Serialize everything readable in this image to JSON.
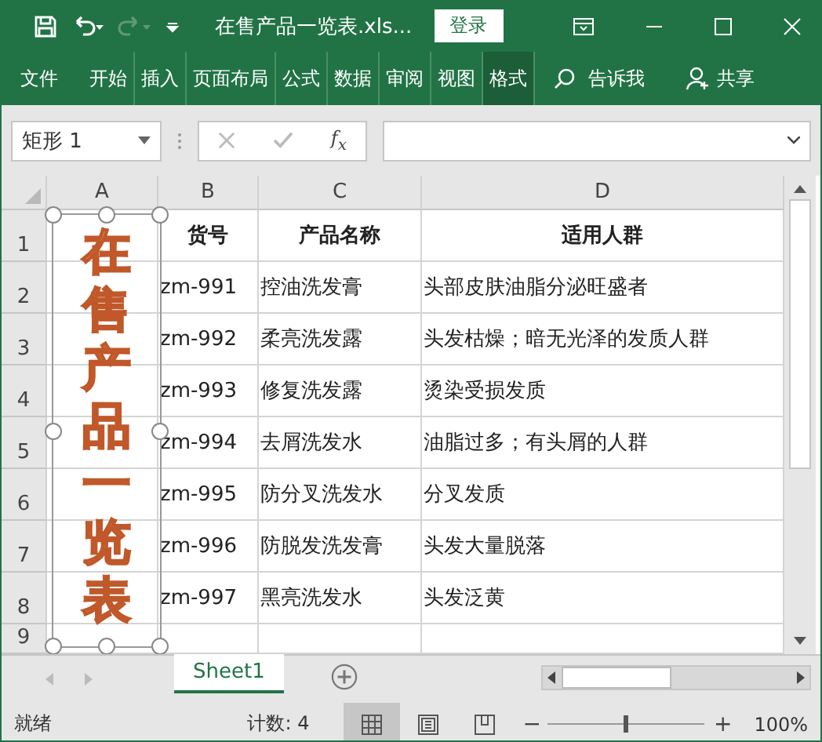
{
  "title_bar": {
    "title": "在售产品一览表.xls...",
    "login": "登录"
  },
  "ribbon_tabs": [
    {
      "label": "文件",
      "selected": false
    },
    {
      "label": "开始",
      "selected": false
    },
    {
      "label": "插入",
      "selected": false
    },
    {
      "label": "页面布局",
      "selected": false
    },
    {
      "label": "公式",
      "selected": false
    },
    {
      "label": "数据",
      "selected": false
    },
    {
      "label": "审阅",
      "selected": false
    },
    {
      "label": "视图",
      "selected": false
    },
    {
      "label": "格式",
      "selected": true
    }
  ],
  "tell_me": "告诉我",
  "share": "共享",
  "formula_bar": {
    "name_box": "矩形 1",
    "fx": "f$_{x}$"
  },
  "columns": [
    "A",
    "B",
    "C",
    "D"
  ],
  "rows": [
    {
      "number": "1",
      "cells": [
        "货号",
        "产品名称",
        "适用人群"
      ]
    },
    {
      "number": "2",
      "cells": [
        "zm-991",
        "控油洗发膏",
        "头部皮肤油脂分泌旺盛者"
      ]
    },
    {
      "number": "3",
      "cells": [
        "zm-992",
        "柔亮洗发露",
        "头发枯燥；暗无光泽的发质人群"
      ]
    },
    {
      "number": "4",
      "cells": [
        "zm-993",
        "修复洗发露",
        "烫染受损发质"
      ]
    },
    {
      "number": "5",
      "cells": [
        "zm-994",
        "去屑洗发水",
        "油脂过多；有头屑的人群"
      ]
    },
    {
      "number": "6",
      "cells": [
        "zm-995",
        "防分叉洗发水",
        "分叉发质"
      ]
    },
    {
      "number": "7",
      "cells": [
        "zm-996",
        "防脱发洗发膏",
        "头发大量脱落"
      ]
    },
    {
      "number": "8",
      "cells": [
        "zm-997",
        "黑亮洗发水",
        "头发泛黄"
      ]
    },
    {
      "number": "9",
      "cells": [
        "",
        "",
        ""
      ]
    }
  ],
  "shape": {
    "text": "在售产品一览表",
    "selected": true
  },
  "sheet_tabs": [
    {
      "label": "Sheet1",
      "selected": true
    }
  ],
  "status_bar": {
    "ready": "就绪",
    "count": "计数: 4",
    "views": [
      {
        "kind": "normal",
        "selected": true
      },
      {
        "kind": "page_layout",
        "selected": false
      },
      {
        "kind": "page_break",
        "selected": false
      }
    ],
    "zoom": {
      "minus": "−",
      "plus": "+",
      "level": 0.5,
      "reading": "100%"
    }
  }
}
